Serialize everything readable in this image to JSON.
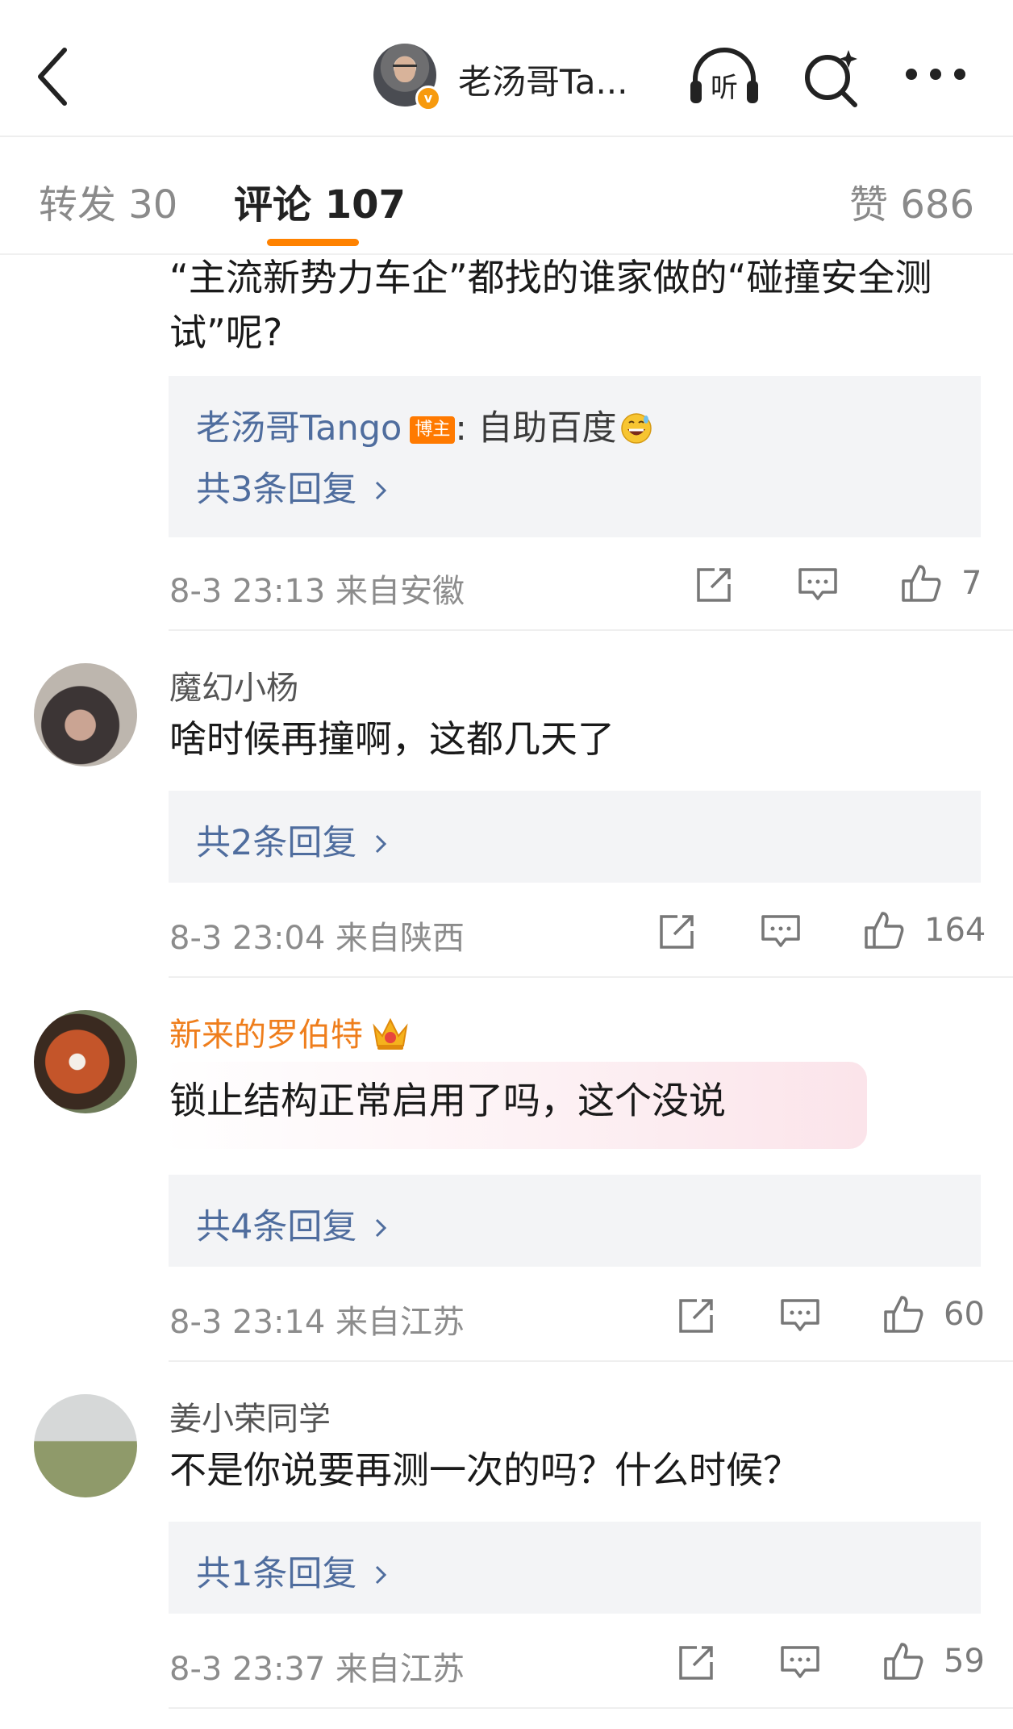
{
  "header": {
    "author_name": "老汤哥Ta...",
    "verified_badge": "v",
    "listen_label": "听"
  },
  "tabs": {
    "repost": "转发 30",
    "comment": "评论 107",
    "like": "赞 686"
  },
  "comments": [
    {
      "text": "“主流新势力车企”都找的谁家做的“碰撞安全测试”呢?",
      "reply": {
        "author": "老汤哥Tango",
        "tag": "博主",
        "text": ": 自助百度",
        "emoji": "grinning-sweat-emoji"
      },
      "more_replies": "共3条回复",
      "meta": "8-3 23:13 来自安徽",
      "likes": "7"
    },
    {
      "user": "魔幻小杨",
      "text": "啥时候再撞啊，这都几天了",
      "more_replies": "共2条回复",
      "meta": "8-3 23:04 来自陕西",
      "likes": "164"
    },
    {
      "user": "新来的罗伯特",
      "user_color": "#ef7e1c",
      "text": "锁止结构正常启用了吗，这个没说",
      "more_replies": "共4条回复",
      "meta": "8-3 23:14 来自江苏",
      "likes": "60"
    },
    {
      "user": "姜小荣同学",
      "text": "不是你说要再测一次的吗？什么时候？",
      "more_replies": "共1条回复",
      "meta": "8-3 23:37 来自江苏",
      "likes": "59"
    }
  ],
  "colors": {
    "accent": "#ff8200",
    "link": "#4f6d9e",
    "vip_name": "#ef7e1c"
  }
}
